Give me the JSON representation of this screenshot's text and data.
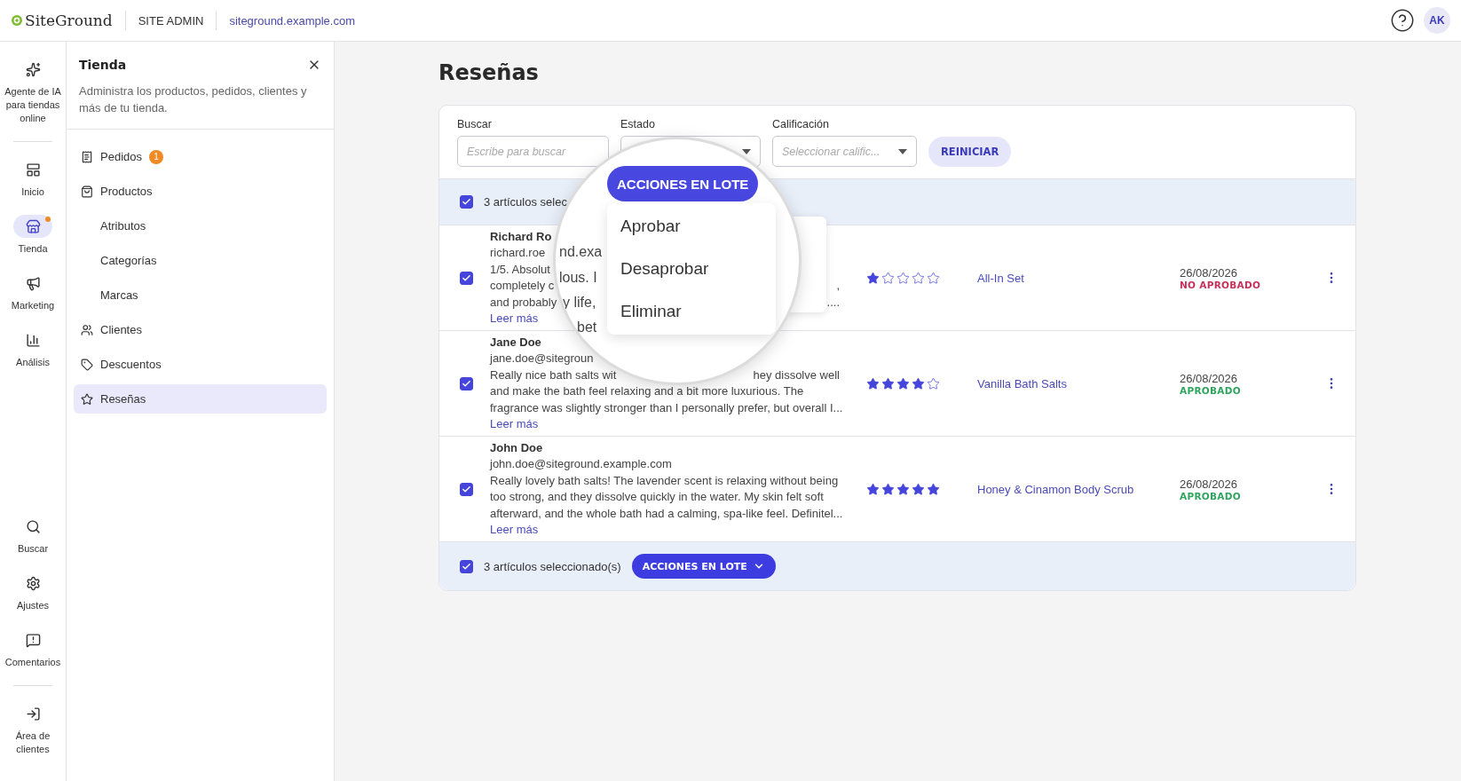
{
  "header": {
    "logo": "SiteGround",
    "section": "SITE ADMIN",
    "domain": "siteground.example.com",
    "avatar": "AK"
  },
  "rail": {
    "top": [
      {
        "label": "Agente de IA para tiendas online",
        "kind": "sparkles",
        "selected": false,
        "notification": false
      },
      {
        "label": "Inicio",
        "kind": "home",
        "selected": false,
        "notification": false
      },
      {
        "label": "Tienda",
        "kind": "store",
        "selected": true,
        "notification": true
      },
      {
        "label": "Marketing",
        "kind": "megaphone",
        "selected": false,
        "notification": false
      },
      {
        "label": "Análisis",
        "kind": "chart",
        "selected": false,
        "notification": false
      }
    ],
    "bottom": [
      {
        "label": "Buscar",
        "kind": "search",
        "selected": false,
        "notification": false
      },
      {
        "label": "Ajustes",
        "kind": "settings",
        "selected": false,
        "notification": false
      },
      {
        "label": "Comentarios",
        "kind": "feedback",
        "selected": false,
        "notification": false
      },
      {
        "label": "Área de clientes",
        "kind": "exit",
        "selected": false,
        "notification": false
      }
    ]
  },
  "panel": {
    "title": "Tienda",
    "description": "Administra los productos, pedidos, clientes y más de tu tienda.",
    "items": [
      {
        "label": "Pedidos",
        "kind": "orders",
        "badge": "1",
        "selected": false
      },
      {
        "label": "Productos",
        "kind": "products",
        "selected": false,
        "children": [
          {
            "label": "Atributos",
            "selected": false
          },
          {
            "label": "Categorías",
            "selected": false
          },
          {
            "label": "Marcas",
            "selected": false
          }
        ]
      },
      {
        "label": "Clientes",
        "kind": "customers",
        "selected": false
      },
      {
        "label": "Descuentos",
        "kind": "discounts",
        "selected": false
      },
      {
        "label": "Reseñas",
        "kind": "reviews",
        "selected": true
      }
    ]
  },
  "page": {
    "title": "Reseñas"
  },
  "filters": [
    {
      "label": "Buscar",
      "kind": "text",
      "placeholder": "Escribe para buscar"
    },
    {
      "label": "Estado",
      "kind": "select"
    },
    {
      "label": "Calificación",
      "kind": "select",
      "placeholder": "Seleccionar calific..."
    }
  ],
  "reset_button": "REINICIAR",
  "top_bulk_bar": {
    "checked": true,
    "text": "3 artículos selec"
  },
  "rows": [
    {
      "checked": true,
      "name": "Richard Ro",
      "email": "richard.roe",
      "lines": [
        [
          "1/5. Absolut"
        ],
        [
          "completely c",
          ","
        ],
        [
          "and probably",
          "...."
        ]
      ],
      "link": "Leer más",
      "stars": 1,
      "product": "All-In Set",
      "date": "26/08/2026",
      "status": {
        "label": "NO APROBADO",
        "kind": "rejected"
      }
    },
    {
      "checked": true,
      "name": "Jane Doe",
      "email": "jane.doe@sitegroun",
      "lines": [
        [
          "Really nice bath salts wit",
          "hey dissolve well"
        ],
        [
          "and make the bath feel relaxing and a bit more luxurious. The"
        ],
        [
          "fragrance was slightly stronger than I personally prefer, but overall I..."
        ]
      ],
      "link": "Leer más",
      "stars": 4,
      "product": "Vanilla Bath Salts",
      "date": "26/08/2026",
      "status": {
        "label": "APROBADO",
        "kind": "approved"
      }
    },
    {
      "checked": true,
      "name": "John Doe",
      "email": "john.doe@siteground.example.com",
      "lines": [
        [
          "Really lovely bath salts! The lavender scent is relaxing without being"
        ],
        [
          "too strong, and they dissolve quickly in the water. My skin felt soft"
        ],
        [
          "afterward, and the whole bath had a calming, spa-like feel. Definitel..."
        ]
      ],
      "link": "Leer más",
      "stars": 5,
      "product": "Honey & Cinamon Body Scrub",
      "date": "26/08/2026",
      "status": {
        "label": "APROBADO",
        "kind": "approved"
      }
    }
  ],
  "bottom_bulk_bar": {
    "checked": true,
    "text": "3 artículos seleccionado(s)",
    "button": "ACCIONES EN LOTE"
  },
  "magnifier": {
    "button": "ACCIONES EN LOTE",
    "menu": [
      "Aprobar",
      "Desaprobar",
      "Eliminar"
    ],
    "background_text": [
      "nd.exa",
      "lous. I",
      "y life,",
      "bet"
    ]
  }
}
